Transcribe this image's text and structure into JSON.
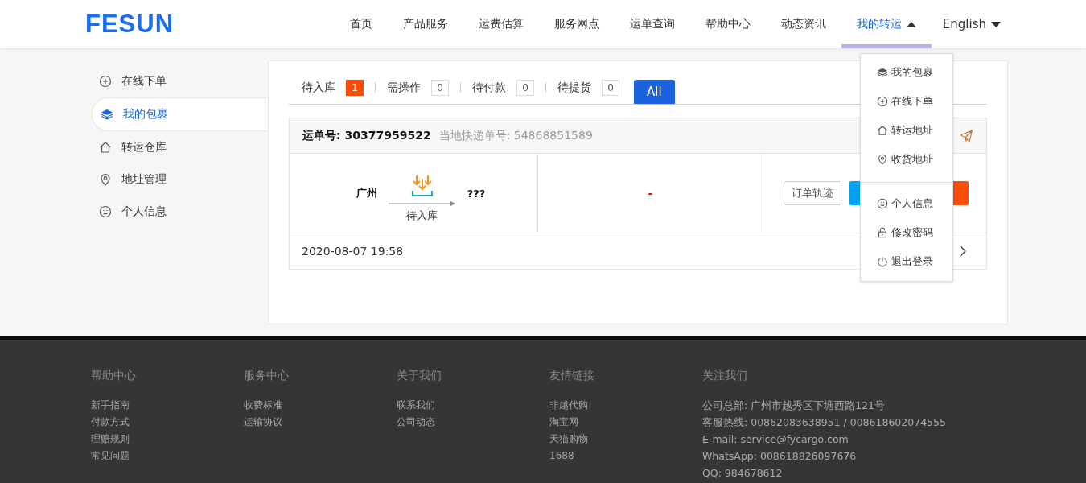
{
  "header": {
    "logo": "FESUN",
    "nav": [
      {
        "label": "首页",
        "selected": false
      },
      {
        "label": "产品服务",
        "selected": false
      },
      {
        "label": "运费估算",
        "selected": false
      },
      {
        "label": "服务网点",
        "selected": false
      },
      {
        "label": "运单查询",
        "selected": false
      },
      {
        "label": "帮助中心",
        "selected": false
      },
      {
        "label": "动态资讯",
        "selected": false
      },
      {
        "label": "我的转运",
        "selected": true,
        "expanded": true
      }
    ],
    "language": "English"
  },
  "dropdown_menu": {
    "groups": [
      [
        {
          "label": "我的包裹"
        },
        {
          "label": "在线下单"
        },
        {
          "label": "转运地址"
        },
        {
          "label": "收货地址"
        }
      ],
      [
        {
          "label": "个人信息"
        },
        {
          "label": "修改密码"
        },
        {
          "label": "退出登录"
        }
      ]
    ]
  },
  "sidebar": {
    "items": [
      {
        "label": "在线下单",
        "selected": false
      },
      {
        "label": "我的包裹",
        "selected": true
      },
      {
        "label": "转运仓库",
        "selected": false
      },
      {
        "label": "地址管理",
        "selected": false
      },
      {
        "label": "个人信息",
        "selected": false
      }
    ]
  },
  "status_tabs": [
    {
      "label": "待入库",
      "count": "1",
      "alert": true,
      "selected": false
    },
    {
      "label": "需操作",
      "count": "0",
      "alert": false,
      "selected": false
    },
    {
      "label": "待付款",
      "count": "0",
      "alert": false,
      "selected": false
    },
    {
      "label": "待提货",
      "count": "0",
      "alert": false,
      "selected": false
    },
    {
      "label": "All",
      "selected": true
    }
  ],
  "order": {
    "waybill_label": "运单号:",
    "waybill_number": "30377959522",
    "local_label": "当地快递单号:",
    "local_number": "54868851589",
    "origin": "广州",
    "stage": "待入库",
    "destination": "???",
    "status": "-",
    "track_button": "订单轨迹",
    "date": "2020-08-07 19:58"
  },
  "footer": {
    "columns": [
      {
        "title": "帮助中心",
        "links": [
          "新手指南",
          "付款方式",
          "理赔规则",
          "常见问题"
        ]
      },
      {
        "title": "服务中心",
        "links": [
          "收费标准",
          "运输协议"
        ]
      },
      {
        "title": "关于我们",
        "links": [
          "联系我们",
          "公司动态"
        ]
      },
      {
        "title": "友情链接",
        "links": [
          "非越代购",
          "淘宝网",
          "天猫购物",
          "1688"
        ]
      },
      {
        "title": "关注我们",
        "lines": [
          "公司总部: 广州市越秀区下塘西路121号",
          "客服热线: 00862083638951 / 008618602074555",
          "E-mail: service@fycargo.com",
          "WhatsApp: 008618826097676",
          "QQ: 984678612"
        ]
      }
    ]
  }
}
